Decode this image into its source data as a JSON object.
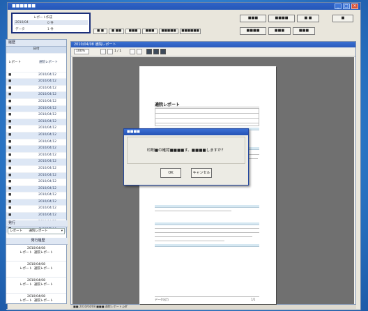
{
  "window": {
    "title": "■■■■■■",
    "controls": [
      "_",
      "□",
      "×"
    ]
  },
  "info_panel": {
    "label_top": "レポート作成",
    "value_mid_left": "2010/04",
    "value_mid_right": "0 件",
    "label_bottom": "データ",
    "value_bottom": "1 件"
  },
  "toolbar_small": [
    "■ ■",
    "■ ■■",
    "■■■",
    "■■■",
    "■■■■■",
    "■■■■■■"
  ],
  "toolbar_right": {
    "row1": [
      "■■■",
      "■■■■",
      "■ ■",
      "■"
    ],
    "row2": [
      "■■■■",
      "■■■",
      "■■■"
    ]
  },
  "left_pane": {
    "header": "履歴",
    "column_header": "日付",
    "featured_label": "レポート",
    "featured_value": "通院レポート",
    "rows": [
      "2010/04/12",
      "2010/04/12",
      "2010/04/12",
      "2010/04/12",
      "2010/04/12",
      "2010/04/12",
      "2010/04/12",
      "2010/04/12",
      "2010/04/12",
      "2010/04/12",
      "2010/04/12",
      "2010/04/12",
      "2010/04/12",
      "2010/04/12",
      "2010/04/12",
      "2010/04/12",
      "2010/04/12",
      "2010/04/12",
      "2010/04/12",
      "2010/04/12",
      "2010/04/12",
      "2010/04/12",
      "2010/04/12",
      "2010/04/12"
    ],
    "section2_header": "発行",
    "filter_label": "レポート",
    "filter_value": "通院レポート",
    "list_header": "発行履歴",
    "entries": [
      {
        "date": "2010/04/08",
        "type": "レポート",
        "title": "通院レポート"
      },
      {
        "date": "2010/04/08",
        "type": "レポート",
        "title": "通院レポート"
      },
      {
        "date": "2010/04/08",
        "type": "レポート",
        "title": "通院レポート"
      },
      {
        "date": "2010/04/08",
        "type": "レポート",
        "title": "通院レポート"
      }
    ]
  },
  "viewer": {
    "title": "2010/04/08 通院レポート",
    "zoom": "100%",
    "page_label": "1 / 1",
    "doc_heading": "通院レポート",
    "footer_left": "データ出力",
    "footer_right": "1/1"
  },
  "dialog": {
    "title": "■■■■",
    "message": "印刷■の確認■■■■す。■■■■しますか？",
    "ok_label": "OK",
    "cancel_label": "キャンセル"
  },
  "statusbar": {
    "text": "■■ 2010/04/08  ■■■  通院レポート.pdf"
  }
}
